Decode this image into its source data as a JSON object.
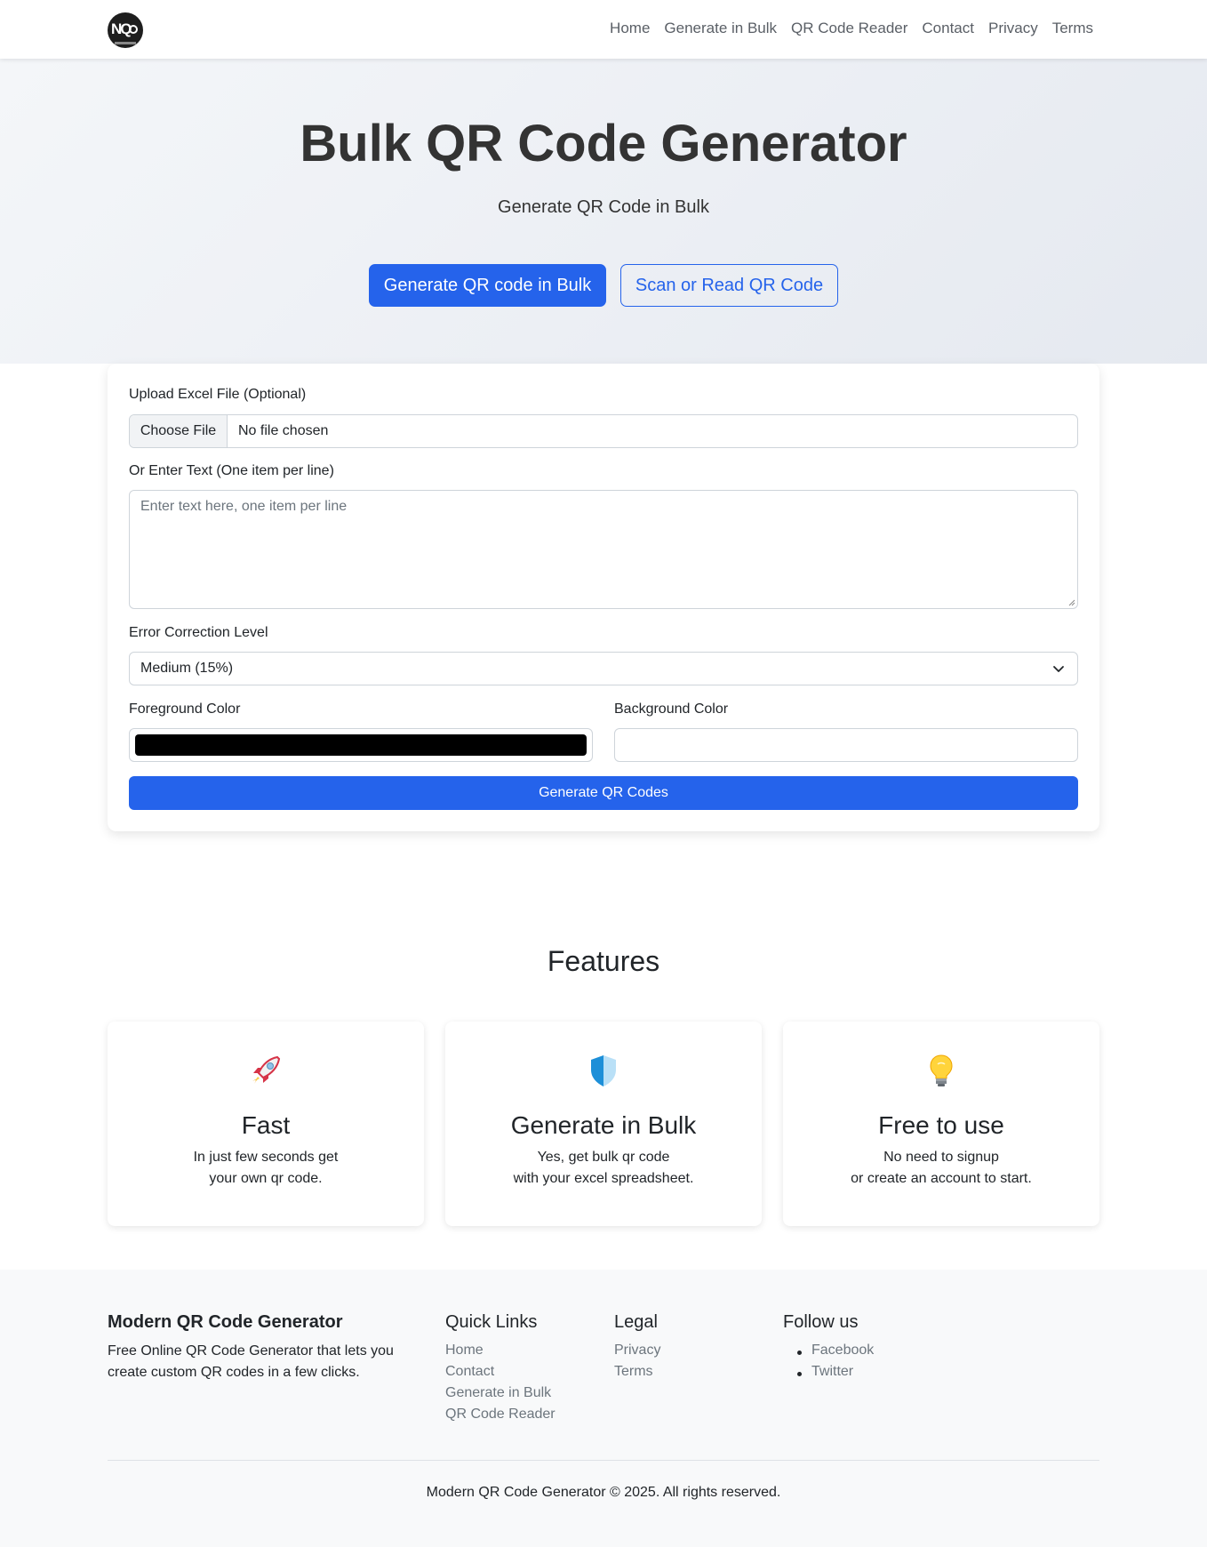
{
  "nav": {
    "logo_text": "NQ",
    "links": [
      "Home",
      "Generate in Bulk",
      "QR Code Reader",
      "Contact",
      "Privacy",
      "Terms"
    ]
  },
  "hero": {
    "title": "Bulk QR Code Generator",
    "subtitle": "Generate QR Code in Bulk",
    "primary_button": "Generate QR code in Bulk",
    "secondary_button": "Scan or Read QR Code"
  },
  "form": {
    "upload_label": "Upload Excel File (Optional)",
    "choose_file": "Choose File",
    "no_file": "No file chosen",
    "text_label": "Or Enter Text (One item per line)",
    "text_placeholder": "Enter text here, one item per line",
    "error_label": "Error Correction Level",
    "error_value": "Medium (15%)",
    "fg_label": "Foreground Color",
    "fg_value": "#000000",
    "bg_label": "Background Color",
    "bg_value": "#ffffff",
    "submit": "Generate QR Codes"
  },
  "features": {
    "title": "Features",
    "items": [
      {
        "icon": "rocket-icon",
        "title": "Fast",
        "line1": "In just few seconds get",
        "line2": "your own qr code."
      },
      {
        "icon": "shield-icon",
        "title": "Generate in Bulk",
        "line1": "Yes, get bulk qr code",
        "line2": "with your excel spreadsheet."
      },
      {
        "icon": "lightbulb-icon",
        "title": "Free to use",
        "line1": "No need to signup",
        "line2": "or create an account to start."
      }
    ]
  },
  "footer": {
    "brand": "Modern QR Code Generator",
    "desc": "Free Online QR Code Generator that lets you create custom QR codes in a few clicks.",
    "quick_links_title": "Quick Links",
    "quick_links": [
      "Home",
      "Contact",
      "Generate in Bulk",
      "QR Code Reader"
    ],
    "legal_title": "Legal",
    "legal_links": [
      "Privacy",
      "Terms"
    ],
    "follow_title": "Follow us",
    "social_links": [
      "Facebook",
      "Twitter"
    ],
    "copyright": "Modern QR Code Generator © 2025. All rights reserved."
  },
  "colors": {
    "primary": "#2563eb",
    "link_muted": "#6c757d"
  }
}
